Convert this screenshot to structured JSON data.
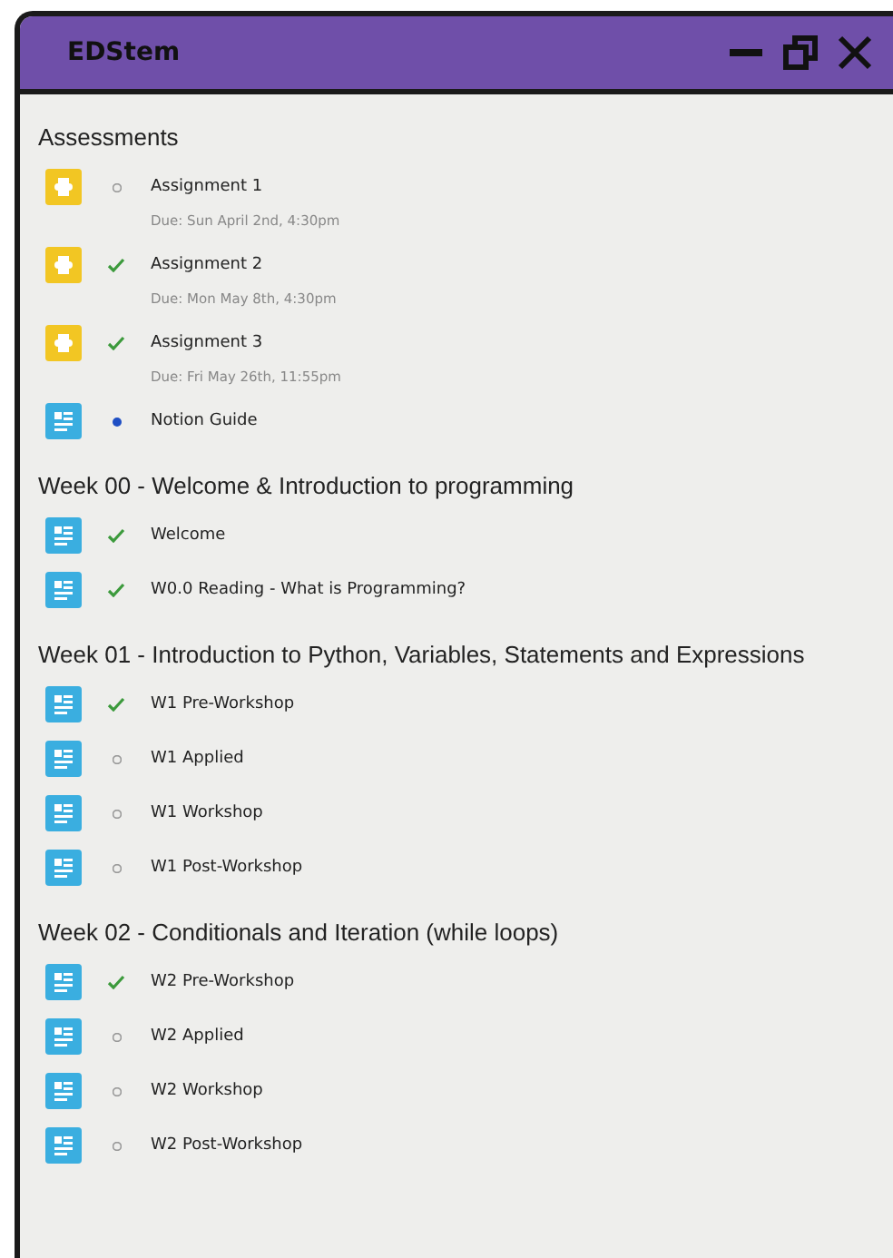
{
  "window": {
    "title": "EDStem"
  },
  "sections": [
    {
      "title": "Assessments",
      "items": [
        {
          "kind": "assessment",
          "completed": false,
          "unread": false,
          "title": "Assignment 1",
          "due": "Due: Sun April 2nd, 4:30pm"
        },
        {
          "kind": "assessment",
          "completed": true,
          "unread": false,
          "title": "Assignment 2",
          "due": "Due: Mon May 8th, 4:30pm"
        },
        {
          "kind": "assessment",
          "completed": true,
          "unread": false,
          "title": "Assignment 3",
          "due": "Due: Fri May 26th, 11:55pm"
        },
        {
          "kind": "lesson",
          "completed": false,
          "unread": true,
          "title": "Notion Guide"
        }
      ]
    },
    {
      "title": "Week 00 - Welcome & Introduction to programming",
      "items": [
        {
          "kind": "lesson",
          "completed": true,
          "unread": false,
          "title": "Welcome"
        },
        {
          "kind": "lesson",
          "completed": true,
          "unread": false,
          "title": "W0.0 Reading - What is Programming?"
        }
      ]
    },
    {
      "title": "Week 01 - Introduction to Python, Variables, Statements and Expressions",
      "items": [
        {
          "kind": "lesson",
          "completed": true,
          "unread": false,
          "title": "W1 Pre-Workshop"
        },
        {
          "kind": "lesson",
          "completed": false,
          "unread": false,
          "title": "W1 Applied"
        },
        {
          "kind": "lesson",
          "completed": false,
          "unread": false,
          "title": "W1 Workshop"
        },
        {
          "kind": "lesson",
          "completed": false,
          "unread": false,
          "title": "W1 Post-Workshop"
        }
      ]
    },
    {
      "title": "Week 02 - Conditionals and Iteration (while loops)",
      "items": [
        {
          "kind": "lesson",
          "completed": true,
          "unread": false,
          "title": "W2 Pre-Workshop"
        },
        {
          "kind": "lesson",
          "completed": false,
          "unread": false,
          "title": "W2 Applied"
        },
        {
          "kind": "lesson",
          "completed": false,
          "unread": false,
          "title": "W2 Workshop"
        },
        {
          "kind": "lesson",
          "completed": false,
          "unread": false,
          "title": "W2 Post-Workshop"
        }
      ]
    }
  ]
}
